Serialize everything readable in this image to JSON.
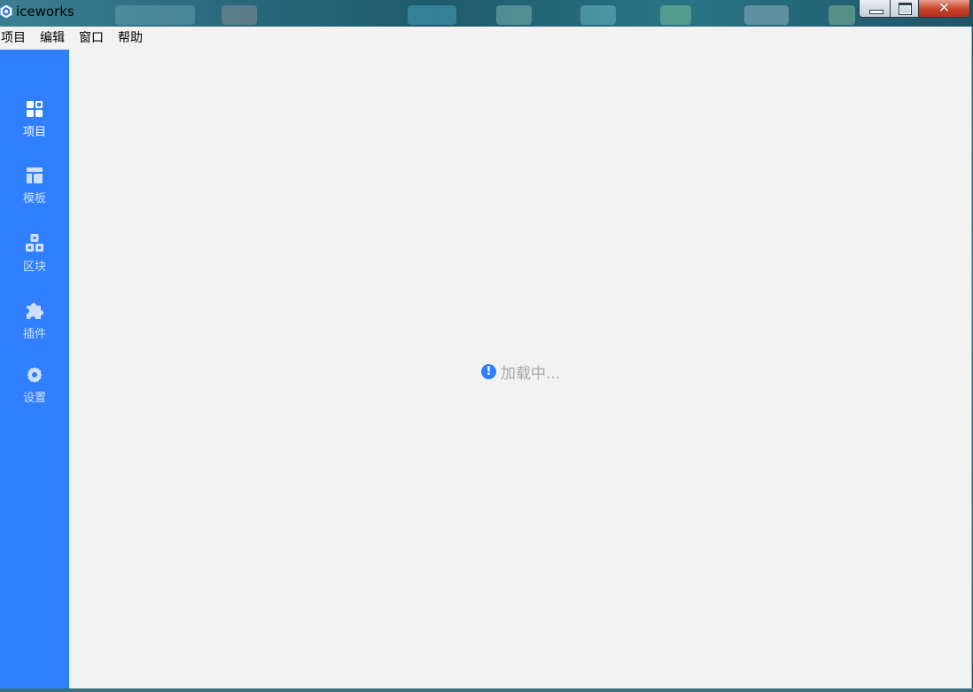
{
  "window": {
    "title": "iceworks",
    "icon": "iceworks-logo-icon",
    "controls": {
      "minimize": "minimize-icon",
      "maximize": "maximize-icon",
      "close": "close-icon"
    }
  },
  "menubar": {
    "items": [
      {
        "label": "项目"
      },
      {
        "label": "编辑"
      },
      {
        "label": "窗口"
      },
      {
        "label": "帮助"
      }
    ]
  },
  "sidebar": {
    "color": "#2f7ffe",
    "items": [
      {
        "label": "项目",
        "icon": "project-grid-icon",
        "active": true
      },
      {
        "label": "模板",
        "icon": "template-layout-icon",
        "active": false
      },
      {
        "label": "区块",
        "icon": "blocks-icon",
        "active": false
      },
      {
        "label": "插件",
        "icon": "plugin-puzzle-icon",
        "active": false
      },
      {
        "label": "设置",
        "icon": "settings-gear-icon",
        "active": false
      }
    ]
  },
  "main": {
    "loading": {
      "icon": "info-exclamation-icon",
      "text": "加载中..."
    }
  }
}
